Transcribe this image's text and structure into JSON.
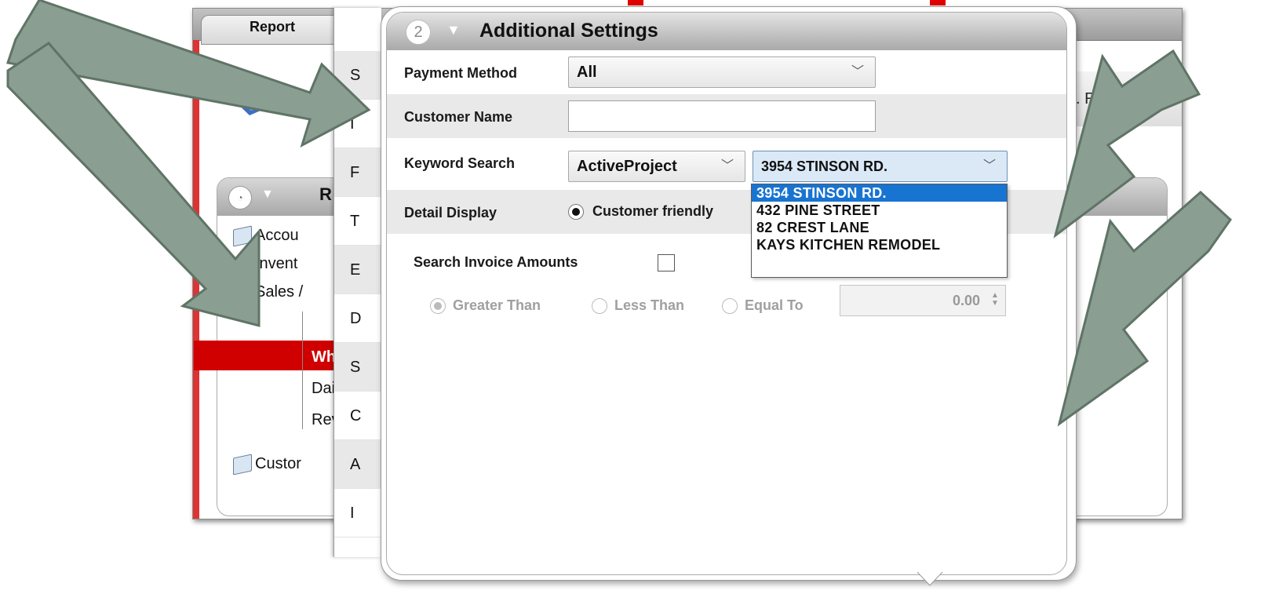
{
  "background_window": {
    "tab_label": "Report",
    "review_text": ". Revi",
    "panel_letter": "R",
    "tree_items": [
      {
        "label": "Accou"
      },
      {
        "label": "Invent"
      },
      {
        "label": "Sales /"
      },
      {
        "label": "Custor"
      }
    ],
    "selected_subitem": "Wh",
    "subitems": [
      "Dai",
      "Rev"
    ]
  },
  "middle_panel": {
    "row_letters": [
      "S",
      "I",
      "F",
      "T",
      "E",
      "D",
      "S",
      "C",
      "A",
      "I"
    ]
  },
  "popup": {
    "section_number": "2",
    "title": "Additional Settings",
    "payment_method": {
      "label": "Payment Method",
      "value": "All"
    },
    "customer_name": {
      "label": "Customer Name",
      "value": ""
    },
    "keyword_search": {
      "label": "Keyword Search",
      "field_value": "ActiveProject",
      "search_value": "3954 STINSON RD.",
      "options": [
        "3954 STINSON RD.",
        "432 PINE STREET",
        "82 CREST LANE",
        "KAYS KITCHEN REMODEL"
      ],
      "selected_index": 0
    },
    "detail_display": {
      "label": "Detail Display",
      "option_label": "Customer friendly"
    },
    "search_invoice_amounts": {
      "label": "Search Invoice Amounts",
      "checked": false
    },
    "amount_filter": {
      "options": [
        "Greater Than",
        "Less Than",
        "Equal To"
      ],
      "selected": "Greater Than",
      "value": "0.00"
    }
  },
  "colors": {
    "arrow_fill": "#8a9e92",
    "arrow_stroke": "#5f7466",
    "highlight_red": "#d10000",
    "dropdown_selected": "#1874d1"
  }
}
